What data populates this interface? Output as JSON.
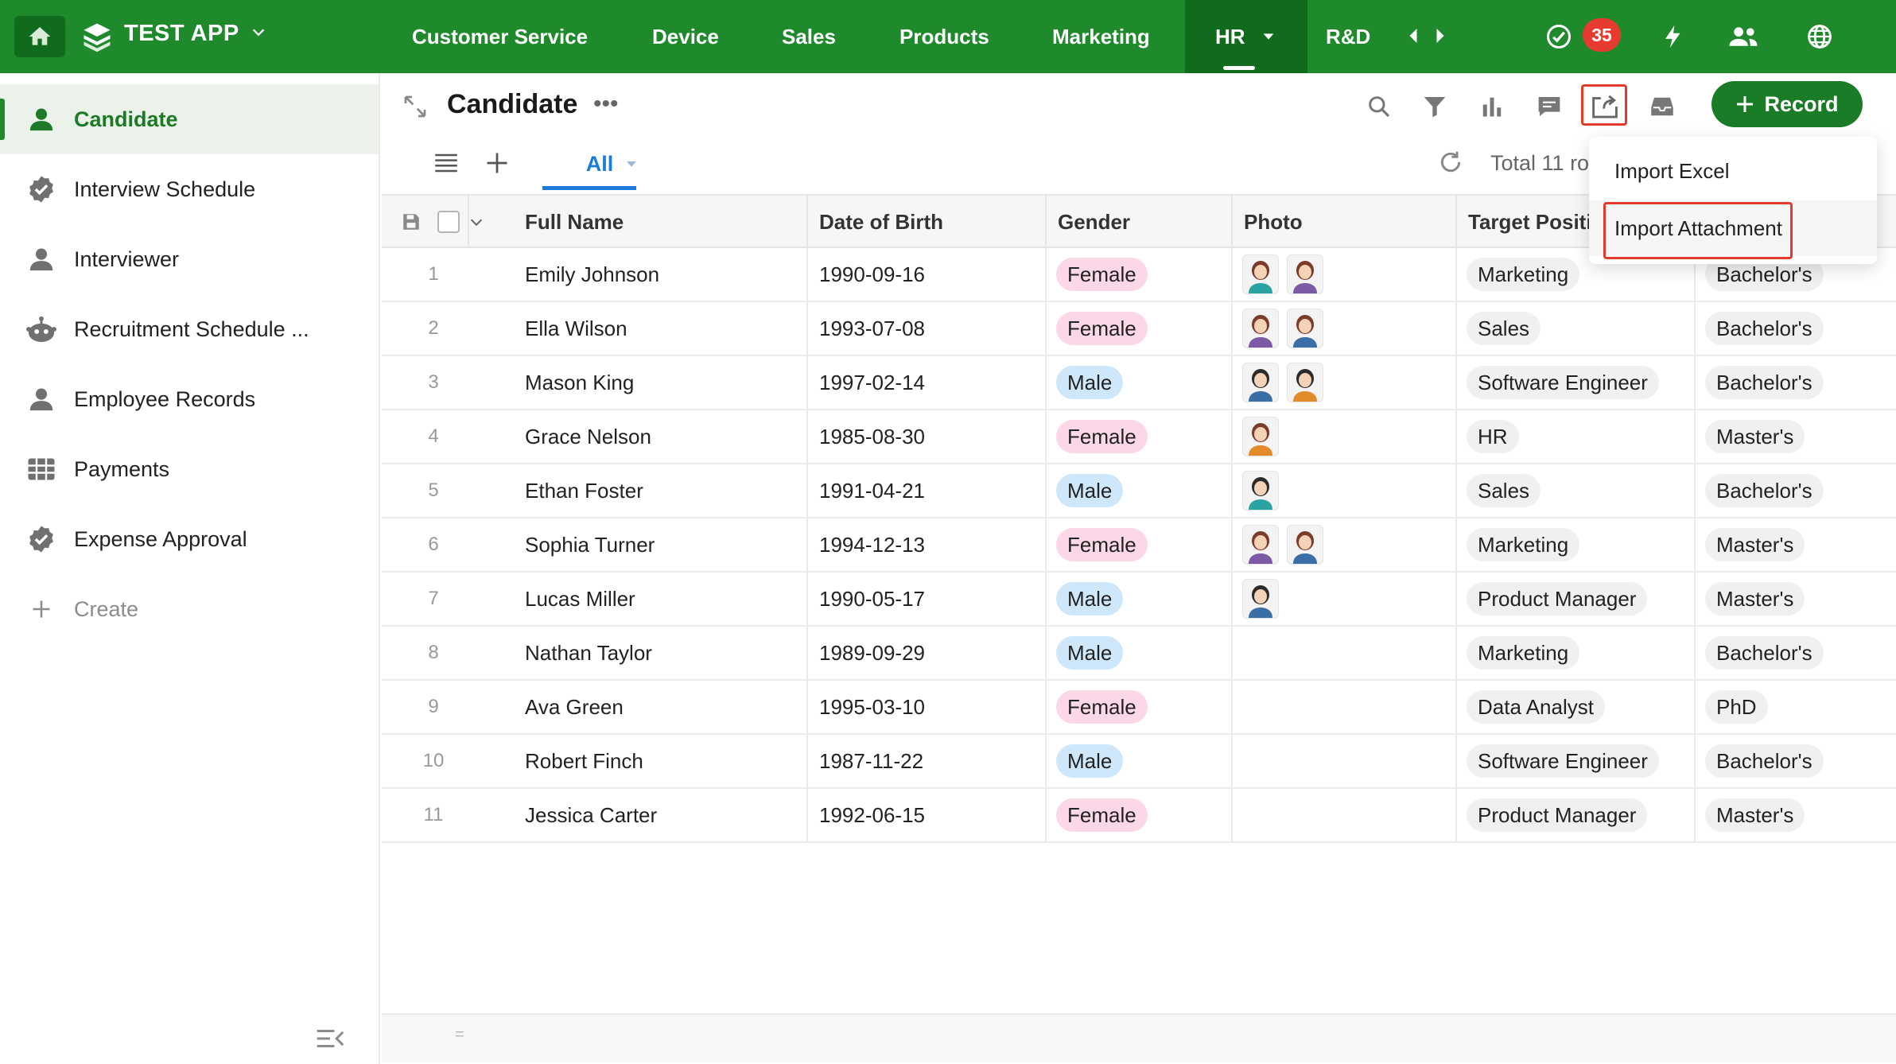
{
  "app": {
    "name": "TEST APP"
  },
  "nav": {
    "items": [
      "Customer Service",
      "Device",
      "Sales",
      "Products",
      "Marketing",
      "HR",
      "R&D"
    ],
    "active": "HR",
    "notification_count": "35"
  },
  "sidebar": {
    "items": [
      {
        "label": "Candidate",
        "icon": "user-icon"
      },
      {
        "label": "Interview Schedule",
        "icon": "badge-check-icon"
      },
      {
        "label": "Interviewer",
        "icon": "user-icon"
      },
      {
        "label": "Recruitment Schedule ...",
        "icon": "robot-icon"
      },
      {
        "label": "Employee Records",
        "icon": "user-icon"
      },
      {
        "label": "Payments",
        "icon": "grid-icon"
      },
      {
        "label": "Expense Approval",
        "icon": "badge-check-icon"
      }
    ],
    "create_label": "Create"
  },
  "page": {
    "title": "Candidate",
    "record_button": "Record",
    "view_tab": "All",
    "total_text": "Total 11 ro"
  },
  "table": {
    "columns": [
      "Full Name",
      "Date of Birth",
      "Gender",
      "Photo",
      "Target Positi"
    ],
    "rows": [
      {
        "num": "1",
        "name": "Emily Johnson",
        "dob": "1990-09-16",
        "gender": "Female",
        "photos": 2,
        "position": "Marketing",
        "education": "Bachelor's"
      },
      {
        "num": "2",
        "name": "Ella Wilson",
        "dob": "1993-07-08",
        "gender": "Female",
        "photos": 2,
        "position": "Sales",
        "education": "Bachelor's"
      },
      {
        "num": "3",
        "name": "Mason King",
        "dob": "1997-02-14",
        "gender": "Male",
        "photos": 2,
        "position": "Software Engineer",
        "education": "Bachelor's"
      },
      {
        "num": "4",
        "name": "Grace Nelson",
        "dob": "1985-08-30",
        "gender": "Female",
        "photos": 1,
        "position": "HR",
        "education": "Master's"
      },
      {
        "num": "5",
        "name": "Ethan Foster",
        "dob": "1991-04-21",
        "gender": "Male",
        "photos": 1,
        "position": "Sales",
        "education": "Bachelor's"
      },
      {
        "num": "6",
        "name": "Sophia Turner",
        "dob": "1994-12-13",
        "gender": "Female",
        "photos": 2,
        "position": "Marketing",
        "education": "Master's"
      },
      {
        "num": "7",
        "name": "Lucas Miller",
        "dob": "1990-05-17",
        "gender": "Male",
        "photos": 1,
        "position": "Product Manager",
        "education": "Master's"
      },
      {
        "num": "8",
        "name": "Nathan Taylor",
        "dob": "1989-09-29",
        "gender": "Male",
        "photos": 0,
        "position": "Marketing",
        "education": "Bachelor's"
      },
      {
        "num": "9",
        "name": "Ava Green",
        "dob": "1995-03-10",
        "gender": "Female",
        "photos": 0,
        "position": "Data Analyst",
        "education": "PhD"
      },
      {
        "num": "10",
        "name": "Robert Finch",
        "dob": "1987-11-22",
        "gender": "Male",
        "photos": 0,
        "position": "Software Engineer",
        "education": "Bachelor's"
      },
      {
        "num": "11",
        "name": "Jessica Carter",
        "dob": "1992-06-15",
        "gender": "Female",
        "photos": 0,
        "position": "Product Manager",
        "education": "Master's"
      }
    ]
  },
  "dropdown": {
    "items": [
      "Import Excel",
      "Import Attachment"
    ]
  },
  "colors": {
    "brand_green": "#1e8a2b",
    "highlight_red": "#e23b2c",
    "tab_blue": "#1c7bd8"
  }
}
